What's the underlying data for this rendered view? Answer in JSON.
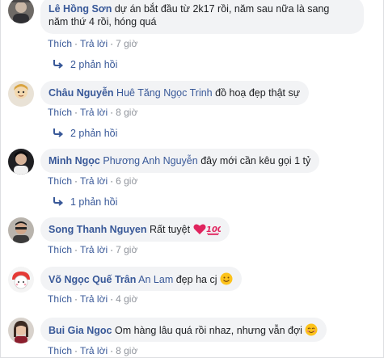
{
  "comments": [
    {
      "author": "Lê Hồng Sơn",
      "mention": "",
      "text_line1": "dự án bắt đầu từ 2k17 rồi, năm sau nữa là sang",
      "text_line2": "năm thứ 4 rồi, hóng quá",
      "like": "Thích",
      "reply": "Trả lời",
      "time": "7 giờ",
      "replies": "2 phản hồi"
    },
    {
      "author": "Châu Nguyễn",
      "mention": "Huê Tăng Ngọc Trinh",
      "text_line1": "đồ hoạ đẹp thật sự",
      "like": "Thích",
      "reply": "Trả lời",
      "time": "8 giờ",
      "replies": "2 phản hồi"
    },
    {
      "author": "Minh Ngọc",
      "mention": "Phương Anh Nguyễn",
      "text_line1": "đây mới cần kêu gọi 1 tỷ",
      "like": "Thích",
      "reply": "Trả lời",
      "time": "6 giờ",
      "replies": "1 phản hồi"
    },
    {
      "author": "Song Thanh Nguyen",
      "mention": "",
      "text_line1": "Rất tuyệt",
      "emoji": [
        "red-heart-icon",
        "hundred-points-icon"
      ],
      "like": "Thích",
      "reply": "Trả lời",
      "time": "7 giờ"
    },
    {
      "author": "Võ Ngọc Quế Trân",
      "mention": "An Lam",
      "text_line1": "đẹp ha cj",
      "emoji": [
        "smiling-face-icon"
      ],
      "like": "Thích",
      "reply": "Trả lời",
      "time": "4 giờ"
    },
    {
      "author": "Bui Gia Ngoc",
      "mention": "",
      "text_line1": "Om hàng lâu quá rồi nhaz, nhưng vẫn đợi",
      "emoji": [
        "smiling-face-icon"
      ],
      "like": "Thích",
      "reply": "Trả lời",
      "time": "8 giờ"
    }
  ],
  "colors": {
    "link": "#385898",
    "bubble": "#f2f3f5",
    "meta": "#90949c"
  }
}
